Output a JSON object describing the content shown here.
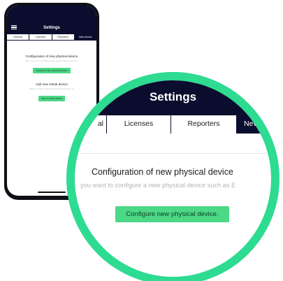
{
  "app": {
    "title": "Settings",
    "tabs": [
      "General",
      "Licenses",
      "Reporters",
      "New device"
    ]
  },
  "phone": {
    "tabs": [
      "General",
      "Licenses",
      "Reporters",
      "New device"
    ],
    "physical_heading": "Configuration of new physical device",
    "physical_subtext": "When you want to configure a new physical device such as E",
    "physical_button": "Configure new physical device",
    "virtual_heading": "Add new virtual device",
    "virtual_subtext": "When you want to add a new virtual device such as",
    "virtual_button": "Add a virtual device"
  },
  "zoom": {
    "tabs": [
      "al",
      "Licenses",
      "Reporters",
      "Nev"
    ],
    "physical_heading": "Configuration of new physical device",
    "physical_subtext": "you want to configure a new physical device such as E",
    "physical_button": "Configure new physical device."
  },
  "colors": {
    "header": "#0b0d2e",
    "accent": "#2ddb91",
    "button": "#4cd887"
  }
}
